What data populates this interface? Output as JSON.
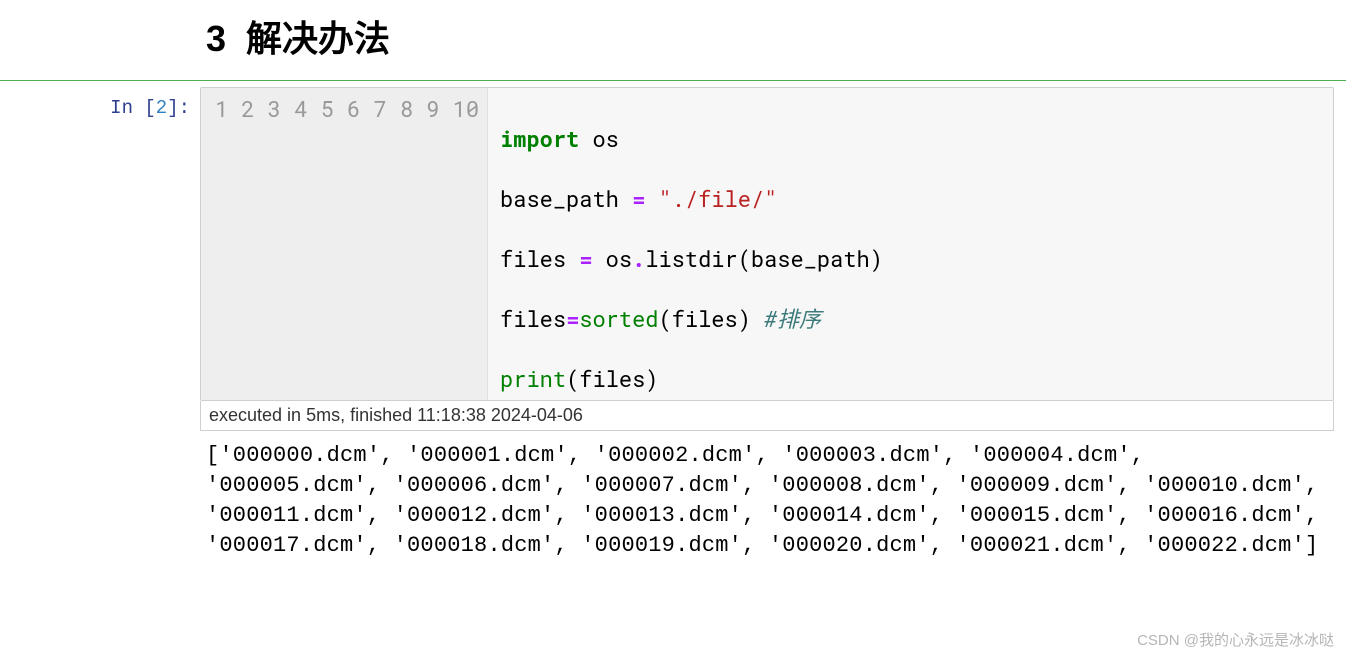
{
  "heading": {
    "number": "3",
    "title": "解决办法"
  },
  "prompt": {
    "label_prefix": "In [",
    "execution_count": "2",
    "label_suffix": "]:"
  },
  "gutter": "1\n2\n3\n4\n5\n6\n7\n8\n9\n10",
  "code": {
    "l1": "",
    "l2_import": "import",
    "l2_os": " os",
    "l3": "",
    "l4_a": "base_path ",
    "l4_eq": "=",
    "l4_b": " ",
    "l4_str": "\"./file/\"",
    "l5": "",
    "l6_a": "files ",
    "l6_eq": "=",
    "l6_b": " os",
    "l6_dot": ".",
    "l6_c": "listdir(base_path)",
    "l7": "",
    "l8_a": "files",
    "l8_eq": "=",
    "l8_sorted": "sorted",
    "l8_b": "(files) ",
    "l8_comment": "#排序",
    "l9": "",
    "l10_print": "print",
    "l10_b": "(files)"
  },
  "timing": "executed in 5ms, finished 11:18:38 2024-04-06",
  "output": "['000000.dcm', '000001.dcm', '000002.dcm', '000003.dcm', '000004.dcm', '000005.dcm', '000006.dcm', '000007.dcm', '000008.dcm', '000009.dcm', '000010.dcm', '000011.dcm', '000012.dcm', '000013.dcm', '000014.dcm', '000015.dcm', '000016.dcm', '000017.dcm', '000018.dcm', '000019.dcm', '000020.dcm', '000021.dcm', '000022.dcm']",
  "watermark": "CSDN @我的心永远是冰冰哒"
}
